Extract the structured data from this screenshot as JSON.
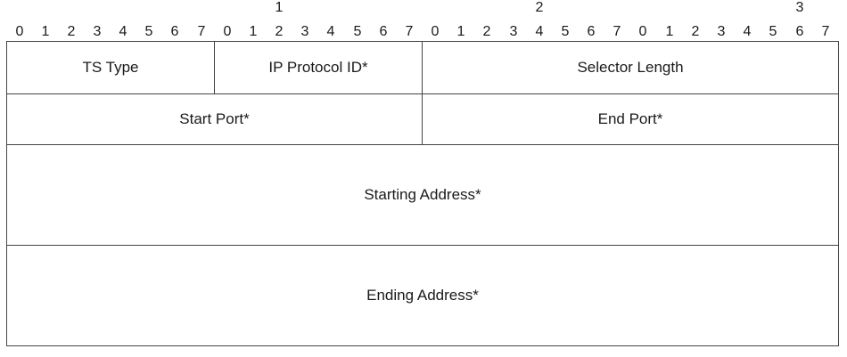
{
  "ruler": {
    "tens": [
      "1",
      "2",
      "3"
    ],
    "ones": [
      "0",
      "1",
      "2",
      "3",
      "4",
      "5",
      "6",
      "7",
      "0",
      "1",
      "2",
      "3",
      "4",
      "5",
      "6",
      "7",
      "0",
      "1",
      "2",
      "3",
      "4",
      "5",
      "6",
      "7",
      "0",
      "1",
      "2",
      "3",
      "4",
      "5",
      "6",
      "7"
    ]
  },
  "fields": {
    "ts_type": "TS Type",
    "ip_protocol_id": "IP Protocol ID*",
    "selector_length": "Selector Length",
    "start_port": "Start Port*",
    "end_port": "End Port*",
    "starting_address": "Starting Address*",
    "ending_address": "Ending Address*"
  }
}
